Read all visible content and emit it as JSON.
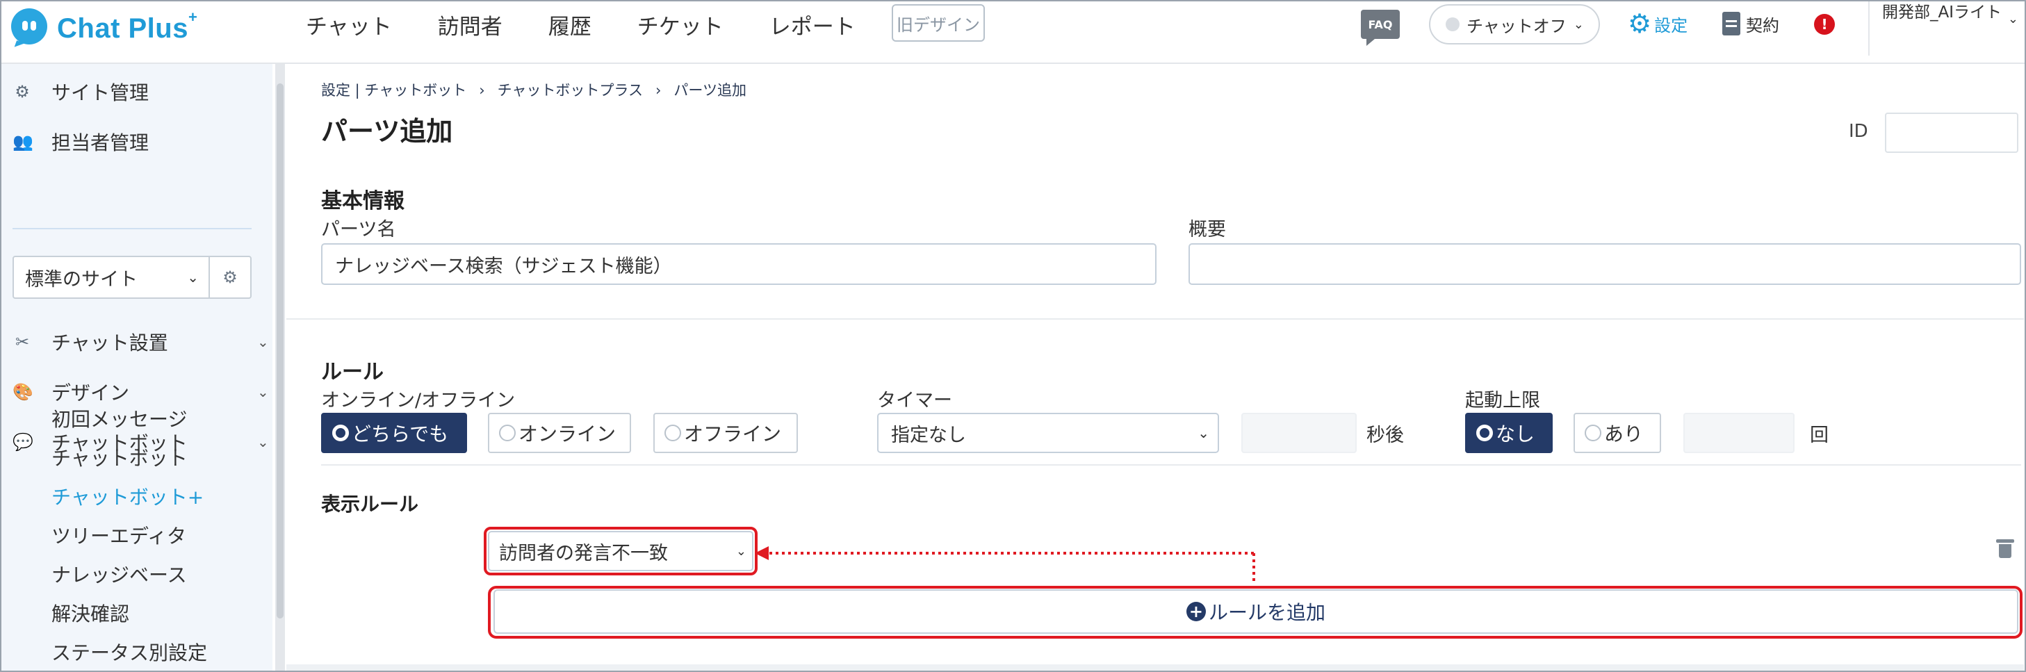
{
  "app": {
    "logo_text": "Chat Plus",
    "logo_sup": "+"
  },
  "nav": {
    "items": [
      "チャット",
      "訪問者",
      "履歴",
      "チケット",
      "レポート"
    ],
    "old_design": "旧デザイン"
  },
  "header": {
    "faq": "FAQ",
    "chat_status": "チャットオフ",
    "settings": "設定",
    "contract": "契約",
    "alert": "!",
    "user": "開発部_AIライト"
  },
  "sidebar": {
    "site_admin": "サイト管理",
    "staff_admin": "担当者管理",
    "site_select": "標準のサイト",
    "chat_settings": "チャット設置",
    "design": "デザイン",
    "chatbot": "チャットボット",
    "chatbot_items": [
      "初回メッセージ",
      "チャットボット",
      "チャットボット+",
      "ツリーエディタ",
      "ナレッジベース",
      "解決確認",
      "ステータス別設定"
    ]
  },
  "page": {
    "breadcrumb": [
      "設定 | チャットボット",
      "›",
      "チャットボットプラス",
      "›",
      "パーツ追加"
    ],
    "title": "パーツ追加",
    "id_label": "ID"
  },
  "basic": {
    "title": "基本情報",
    "name_label": "パーツ名",
    "name_value": "ナレッジベース検索（サジェスト機能）",
    "summary_label": "概要",
    "summary_value": ""
  },
  "rules": {
    "title": "ルール",
    "online_label": "オンライン/オフライン",
    "online_options": [
      "どちらでも",
      "オンライン",
      "オフライン"
    ],
    "timer_label": "タイマー",
    "timer_value": "指定なし",
    "timer_unit": "秒後",
    "limit_label": "起動上限",
    "limit_options": [
      "なし",
      "あり"
    ],
    "limit_unit": "回"
  },
  "display_rules": {
    "title": "表示ルール",
    "rule_value": "訪問者の発言不一致",
    "add_rule": "ルールを追加"
  },
  "colors": {
    "accent": "#1f9bd7",
    "primary": "#243a67",
    "highlight": "#e01a22"
  }
}
